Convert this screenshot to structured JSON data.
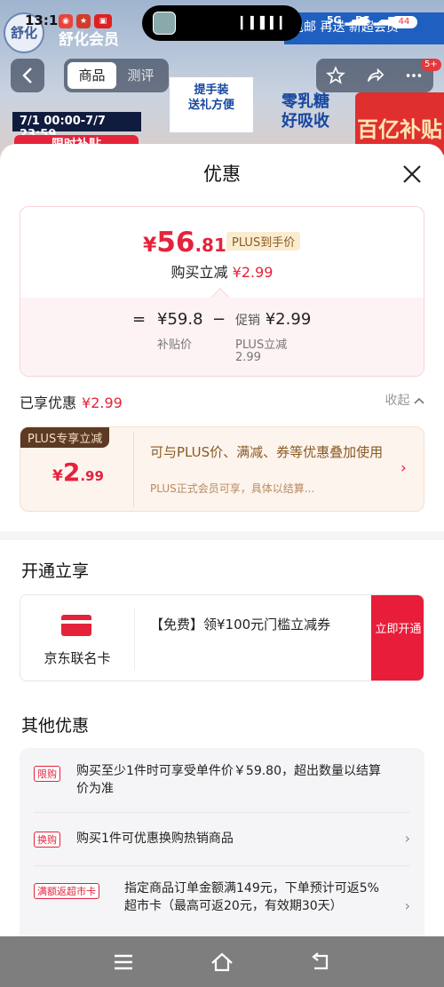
{
  "status_bar": {
    "time": "13:14",
    "network_1": "5G",
    "network_2": "5G",
    "battery": "44"
  },
  "background_page": {
    "brand_logo_text": "舒化",
    "brand_text": "舒化会员",
    "top_right_text": "包邮 再送 新超会员",
    "promo_time": "7/1 00:00-7/7 23:59",
    "promo_label": "限时补贴",
    "box_carry_line1": "提手装",
    "box_carry_line2": "送礼方便",
    "box_milk_line1": "零乳糖",
    "box_milk_line2": "好吸收",
    "box_subsidy": "百亿补贴",
    "tabs": [
      "商品",
      "测评"
    ],
    "message_badge": "5+"
  },
  "sheet": {
    "title": "优惠",
    "price_card": {
      "currency": "¥",
      "price_int": "56",
      "price_dec": ".81",
      "plus_tag": "PLUS到手价",
      "cut_label": "购买立减",
      "cut_value": "¥2.99",
      "formula_eq": "=",
      "formula_minus": "−",
      "subsidy_price": "¥59.8",
      "subsidy_label": "补贴价",
      "promo_prefix": "促销",
      "promo_value": "¥2.99",
      "promo_sub_label": "PLUS立减",
      "promo_sub_value": "2.99"
    },
    "enjoyed": {
      "label": "已享优惠",
      "value": "¥2.99",
      "collapse": "收起"
    },
    "plus_card": {
      "header": "PLUS专享立减",
      "currency": "¥",
      "amount_int": "2",
      "amount_dec": ".99",
      "desc": "可与PLUS价、满减、券等优惠叠加使用",
      "sub_desc": "PLUS正式会员可享，具体以结算..."
    },
    "open_section": {
      "title": "开通立享",
      "card_name": "京东联名卡",
      "desc": "【免费】领¥100元门槛立减券",
      "open_button": "立即开通"
    },
    "other_section": {
      "title": "其他优惠",
      "items": [
        {
          "tag": "限购",
          "text": "购买至少1件时可享受单件价￥59.80，超出数量以结算价为准"
        },
        {
          "tag": "换购",
          "text": "购买1件可优惠换购热销商品"
        },
        {
          "tag": "满额返超市卡",
          "text": "指定商品订单金额满149元，下单预计可返5%超市卡（最高可返20元，有效期30天）"
        }
      ]
    }
  },
  "colors": {
    "accent_red": "#e4233b",
    "plus_brown": "#8a5a22"
  },
  "icons": [
    "back-icon",
    "star-icon",
    "share-icon",
    "more-icon",
    "close-icon",
    "chevron-up-icon",
    "chevron-right-icon",
    "menu-icon",
    "home-icon",
    "return-icon"
  ]
}
